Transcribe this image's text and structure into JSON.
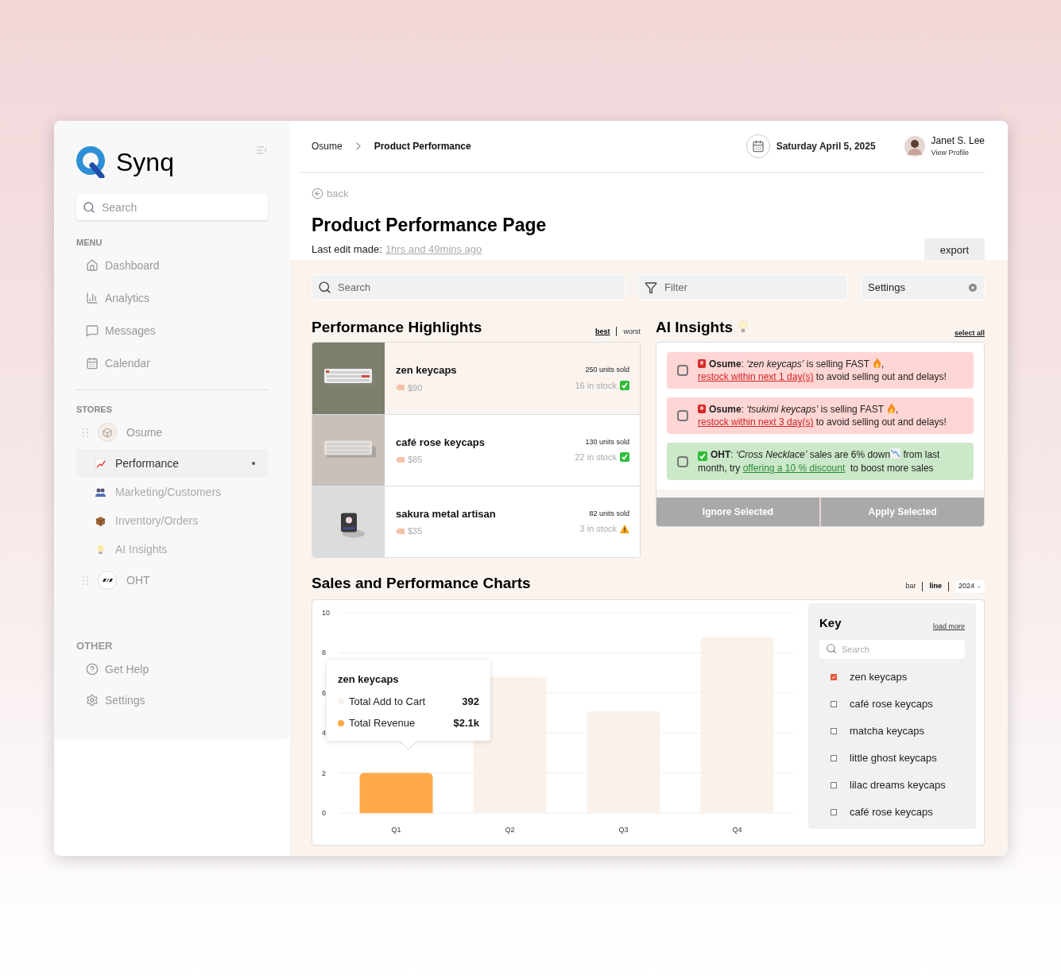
{
  "sidebar": {
    "brand": "Synq",
    "search": {
      "placeholder": "Search"
    },
    "menu_title": "MENU",
    "menu": [
      {
        "label": "Dashboard"
      },
      {
        "label": "Analytics"
      },
      {
        "label": "Messages"
      },
      {
        "label": "Calendar"
      }
    ],
    "stores_title": "STORES",
    "stores": [
      {
        "name": "Osume",
        "children": [
          {
            "label": "Performance",
            "selected": true
          },
          {
            "label": "Marketing/Customers",
            "selected": false
          },
          {
            "label": "Inventory/Orders",
            "selected": false
          },
          {
            "label": "AI Insights",
            "selected": false
          }
        ]
      },
      {
        "name": "OHT"
      }
    ],
    "other_title": "OTHER",
    "other": [
      {
        "label": "Get Help"
      },
      {
        "label": "Settings"
      }
    ]
  },
  "header": {
    "breadcrumb": [
      "Osume",
      "Product Performance"
    ],
    "date": "Saturday April 5, 2025",
    "user": {
      "name": "Janet S. Lee",
      "link": "View Profile"
    }
  },
  "page": {
    "back": "back",
    "title": "Product Performance Page",
    "last_edit_label": "Last edit made:",
    "last_edit_value": "1hrs and 49mins ago",
    "export": "export"
  },
  "toolbar": {
    "search": {
      "placeholder": "Search"
    },
    "filter": {
      "placeholder": "Filter"
    },
    "settings": "Settings"
  },
  "highlights": {
    "title": "Performance Highlights",
    "toggles": [
      {
        "label": "best",
        "selected": true
      },
      {
        "label": "worst",
        "selected": false
      }
    ],
    "items": [
      {
        "name": "zen keycaps",
        "price": "$90",
        "sold": "250 units sold",
        "stock": "16 in stock",
        "kind": "ok",
        "selected": true
      },
      {
        "name": "café rose keycaps",
        "price": "$85",
        "sold": "130 units sold",
        "stock": "22 in stock",
        "kind": "ok",
        "selected": false
      },
      {
        "name": "sakura metal artisan",
        "price": "$35",
        "sold": "82 units sold",
        "stock": "3 in stock",
        "kind": "low",
        "selected": false
      }
    ]
  },
  "insights": {
    "title": "AI Insights",
    "select_all": "select all",
    "items": [
      {
        "kind": "alert",
        "checked": false,
        "lead": "**Osume**: *‘zen keycaps’* is selling FAST",
        "mid": ", ",
        "link": "restock within next 1 day(s)",
        "tail": " to avoid selling out and delays!"
      },
      {
        "kind": "alert",
        "checked": false,
        "lead": "**Osume**: *‘tsukimi keycaps’* is selling FAST",
        "mid": ", ",
        "link": "restock within next 3 day(s)",
        "tail": " to avoid selling out and delays!"
      },
      {
        "kind": "good",
        "checked": false,
        "lead": "**OHT**: *‘Cross Necklace’* sales are 6% down",
        "mid": " from last month, try ",
        "link": "offering a 10 % discount",
        "tail": "  to boost more sales"
      }
    ],
    "buttons": [
      {
        "label": "Ignore Selected",
        "disabled": true
      },
      {
        "label": "Apply Selected",
        "disabled": true
      }
    ]
  },
  "charts": {
    "title": "Sales and Performance Charts",
    "types": [
      {
        "label": "bar",
        "selected": false
      },
      {
        "label": "line",
        "selected": true
      }
    ],
    "year": "2024",
    "chart_data": {
      "type": "bar",
      "categories": [
        "Q1",
        "Q2",
        "Q3",
        "Q4"
      ],
      "ylim": [
        0,
        10
      ],
      "yticks": [
        0,
        2,
        4,
        6,
        8,
        10
      ],
      "grid": true,
      "legend": true,
      "series": [
        {
          "name": "Total Add to Cart",
          "color": "#faf1ea",
          "values": [
            null,
            6.8,
            5.1,
            8.8
          ]
        },
        {
          "name": "Total Revenue",
          "color": "#ffa94a",
          "values": [
            2,
            null,
            null,
            null
          ]
        }
      ]
    },
    "tooltip": {
      "title": "zen keycaps",
      "values": [
        "392",
        "$2.1k"
      ]
    },
    "key": {
      "title": "Key",
      "load_more": "load more",
      "search": {
        "placeholder": "Search"
      },
      "items": [
        {
          "label": "zen keycaps",
          "checked": true
        },
        {
          "label": "café rose keycaps",
          "checked": false
        },
        {
          "label": "matcha keycaps",
          "checked": false
        },
        {
          "label": "little ghost keycaps",
          "checked": false
        },
        {
          "label": "lilac dreams keycaps",
          "checked": false
        },
        {
          "label": "café rose keycaps",
          "checked": false
        }
      ]
    }
  }
}
